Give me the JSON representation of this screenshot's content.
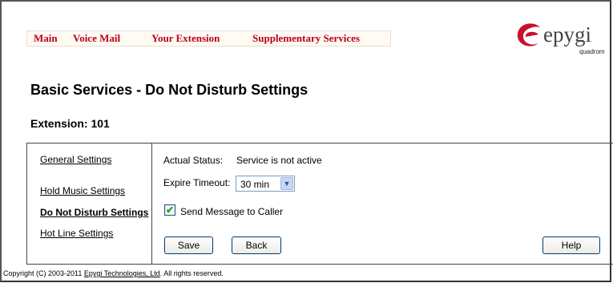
{
  "nav": {
    "items": [
      {
        "label": "Main"
      },
      {
        "label": "Voice Mail"
      },
      {
        "label": "Your Extension"
      },
      {
        "label": "Supplementary Services"
      }
    ]
  },
  "logo": {
    "text": "epygi",
    "sub": "quadrom",
    "color": "#c8102e"
  },
  "page": {
    "title": "Basic Services - Do Not Disturb Settings",
    "extension": "Extension: 101"
  },
  "sidebar": {
    "items": [
      {
        "label": "General Settings",
        "active": false
      },
      {
        "label": "Hold Music Settings",
        "active": false
      },
      {
        "label": "Do Not Disturb Settings",
        "active": true
      },
      {
        "label": "Hot Line Settings",
        "active": false
      }
    ]
  },
  "form": {
    "status_label": "Actual Status:",
    "status_value": "Service is not active",
    "timeout_label": "Expire Timeout:",
    "timeout_value": "30 min",
    "send_message_label": "Send Message to Caller",
    "send_message_checked": true
  },
  "buttons": {
    "save": "Save",
    "back": "Back",
    "help": "Help"
  },
  "footer": {
    "prefix": "Copyright (C) 2003-2011 ",
    "link": "Epygi Technologies, Ltd",
    "suffix": ". All rights reserved."
  }
}
